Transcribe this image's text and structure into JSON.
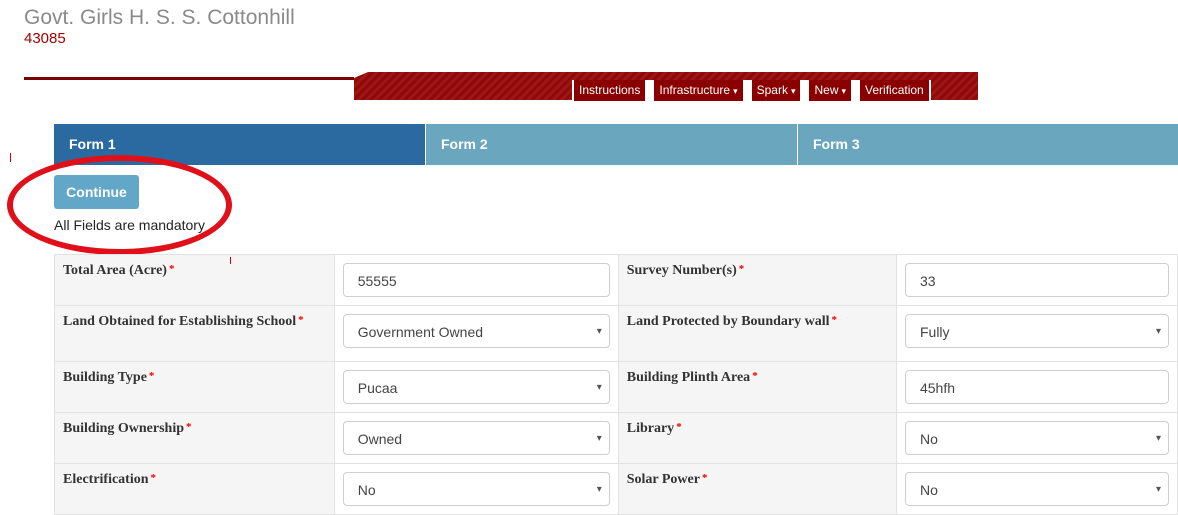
{
  "header": {
    "school_name": "Govt. Girls H. S. S. Cottonhill",
    "school_code": "43085"
  },
  "nav": {
    "items": [
      {
        "label": "Instructions",
        "caret": ""
      },
      {
        "label": "Infrastructure",
        "caret": "▾"
      },
      {
        "label": "Spark",
        "caret": "▾"
      },
      {
        "label": "New",
        "caret": "▾"
      },
      {
        "label": "Verification",
        "caret": ""
      }
    ]
  },
  "tabs": [
    {
      "label": "Form 1",
      "active": true
    },
    {
      "label": "Form 2",
      "active": false
    },
    {
      "label": "Form 3",
      "active": false
    }
  ],
  "continue_label": "Continue",
  "mandatory_note": "All Fields are mandatory",
  "required_marker": "*",
  "select_arrow": "▾",
  "rows": [
    {
      "left": {
        "label": "Total Area (Acre)",
        "value": "55555",
        "type": "input"
      },
      "right": {
        "label": "Survey Number(s)",
        "value": "33",
        "type": "input"
      }
    },
    {
      "left": {
        "label": "Land Obtained for Establishing School",
        "value": "Government Owned",
        "type": "select"
      },
      "right": {
        "label": "Land Protected by Boundary wall",
        "value": "Fully",
        "type": "select"
      }
    },
    {
      "left": {
        "label": "Building Type",
        "value": "Pucaa",
        "type": "select"
      },
      "right": {
        "label": "Building Plinth Area",
        "value": "45hfh",
        "type": "input"
      }
    },
    {
      "left": {
        "label": "Building Ownership",
        "value": "Owned",
        "type": "select"
      },
      "right": {
        "label": "Library",
        "value": "No",
        "type": "select"
      }
    },
    {
      "left": {
        "label": "Electrification",
        "value": "No",
        "type": "select"
      },
      "right": {
        "label": "Solar Power",
        "value": "No",
        "type": "select"
      }
    }
  ],
  "colors": {
    "brand_red": "#8a0000",
    "tab_active": "#2a6aa1",
    "tab_inactive": "#6aa7be",
    "button": "#63a7c8",
    "annotation_circle": "#e0101a"
  }
}
